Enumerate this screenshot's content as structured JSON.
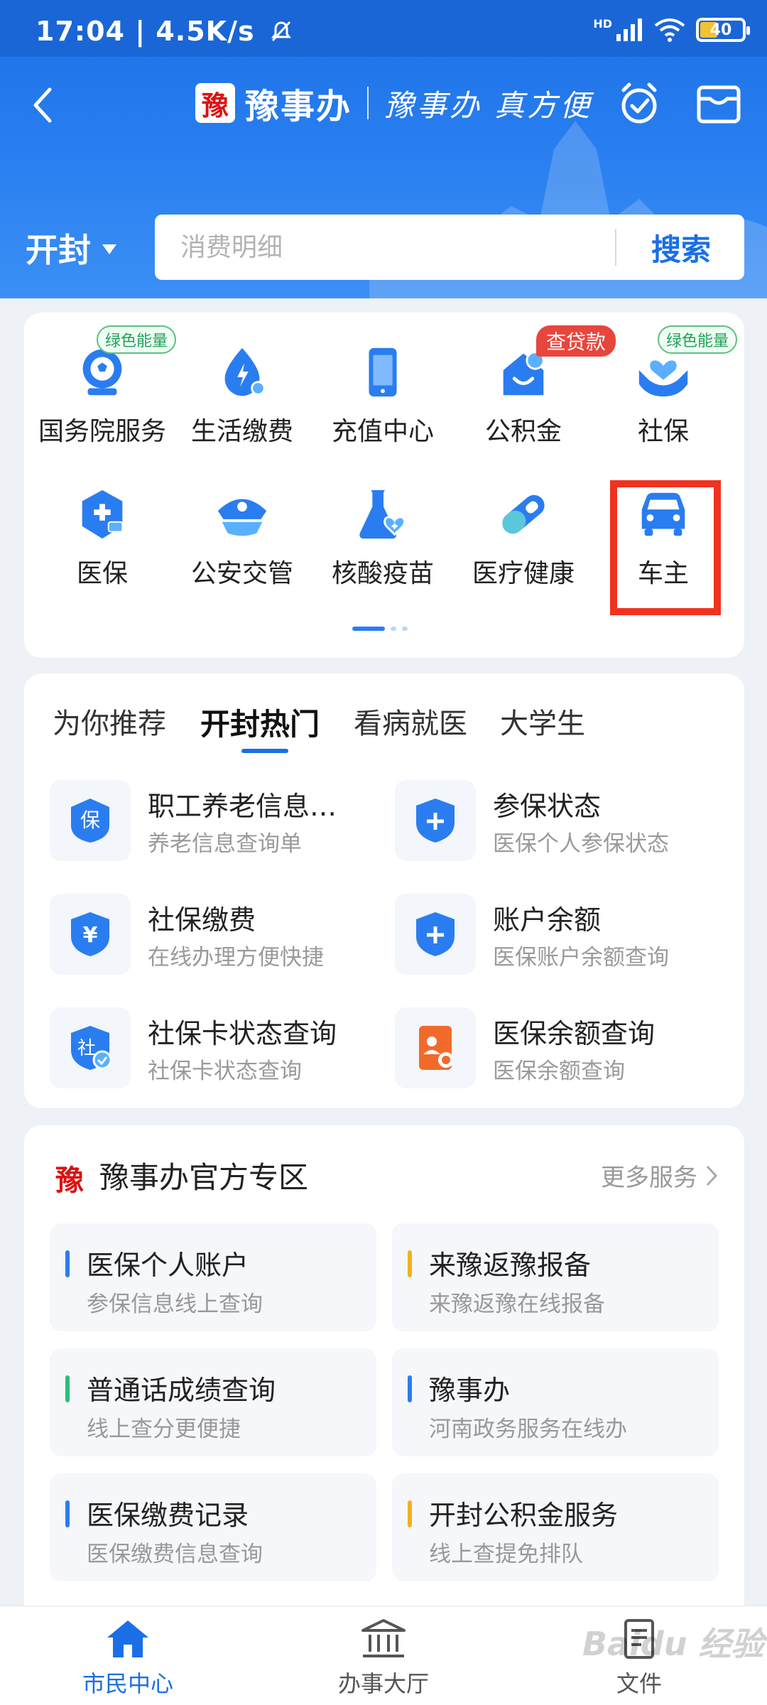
{
  "status_bar": {
    "time": "17:04",
    "speed": "4.5K/s",
    "signal": "HD",
    "battery": "40"
  },
  "header": {
    "brand_logo": "豫",
    "brand_name": "豫事办",
    "brand_slogan": "豫事办 真方便",
    "city": "开封",
    "search_placeholder": "消费明细",
    "search_button": "搜索",
    "colors": {
      "primary": "#1b6fe6",
      "accent": "#2a80f0"
    }
  },
  "services_grid": {
    "items": [
      {
        "label": "国务院服务",
        "icon": "state-council-icon",
        "tag": "绿色能量",
        "tag_style": "green"
      },
      {
        "label": "生活缴费",
        "icon": "utility-payment-icon"
      },
      {
        "label": "充值中心",
        "icon": "phone-recharge-icon"
      },
      {
        "label": "公积金",
        "icon": "housing-fund-icon",
        "tag": "查贷款",
        "tag_style": "red"
      },
      {
        "label": "社保",
        "icon": "social-security-icon",
        "tag": "绿色能量",
        "tag_style": "green"
      },
      {
        "label": "医保",
        "icon": "medical-insurance-icon"
      },
      {
        "label": "公安交管",
        "icon": "police-cap-icon"
      },
      {
        "label": "核酸疫苗",
        "icon": "flask-vaccine-icon"
      },
      {
        "label": "医疗健康",
        "icon": "pill-health-icon"
      },
      {
        "label": "车主",
        "icon": "car-owner-icon",
        "highlighted": true
      }
    ],
    "page": 1,
    "page_count": 3
  },
  "hot": {
    "tabs": [
      "为你推荐",
      "开封热门",
      "看病就医",
      "大学生"
    ],
    "active_tab": 1,
    "items": [
      {
        "title": "职工养老信息…",
        "sub": "养老信息查询单",
        "icon": "pension-icon"
      },
      {
        "title": "参保状态",
        "sub": "医保个人参保状态",
        "icon": "shield-plus-icon"
      },
      {
        "title": "社保缴费",
        "sub": "在线办理方便快捷",
        "icon": "shield-yuan-icon"
      },
      {
        "title": "账户余额",
        "sub": "医保账户余额查询",
        "icon": "shield-plus-icon"
      },
      {
        "title": "社保卡状态查询",
        "sub": "社保卡状态查询",
        "icon": "shield-check-icon"
      },
      {
        "title": "医保余额查询",
        "sub": "医保余额查询",
        "icon": "id-card-icon"
      }
    ],
    "icon_glyphs": {
      "pension": "保",
      "yuan": "¥",
      "plus": "+",
      "she": "社"
    }
  },
  "official": {
    "logo": "豫",
    "title": "豫事办官方专区",
    "more": "更多服务",
    "items": [
      {
        "title": "医保个人账户",
        "sub": "参保信息线上查询",
        "color": "#2a7df0"
      },
      {
        "title": "来豫返豫报备",
        "sub": "来豫返豫在线报备",
        "color": "#f2b21c"
      },
      {
        "title": "普通话成绩查询",
        "sub": "线上查分更便捷",
        "color": "#2cc079"
      },
      {
        "title": "豫事办",
        "sub": "河南政务服务在线办",
        "color": "#2a7df0"
      },
      {
        "title": "医保缴费记录",
        "sub": "医保缴费信息查询",
        "color": "#2a7df0"
      },
      {
        "title": "开封公积金服务",
        "sub": "线上查提免排队",
        "color": "#f2b21c"
      }
    ]
  },
  "bottom_nav": {
    "items": [
      {
        "label": "市民中心",
        "icon": "home-icon",
        "active": true
      },
      {
        "label": "办事大厅",
        "icon": "hall-icon"
      },
      {
        "label": "文件",
        "icon": "document-icon"
      }
    ],
    "active_color": "#1a6fe6"
  },
  "watermark": "Baidu 经验"
}
